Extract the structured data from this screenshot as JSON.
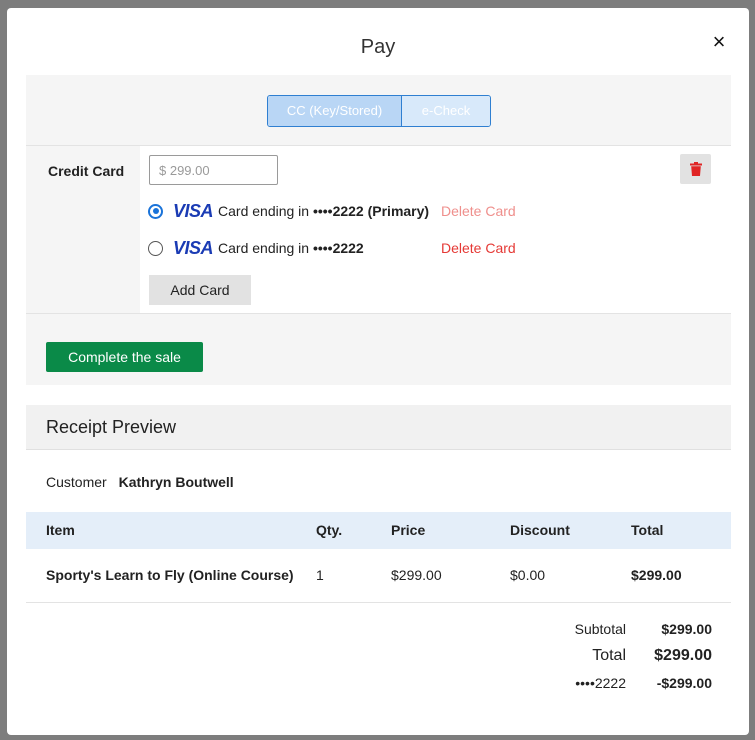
{
  "modal": {
    "title": "Pay",
    "close_glyph": "×"
  },
  "payment_tabs": [
    {
      "label": "CC (Key/Stored)",
      "active": true
    },
    {
      "label": "e-Check",
      "active": false
    }
  ],
  "credit_card": {
    "section_label": "Credit Card",
    "amount_placeholder": "$ 299.00",
    "cards": [
      {
        "brand": "VISA",
        "prefix": "Card ending in",
        "digits": "••••2222 (Primary)",
        "delete_label": "Delete Card",
        "selected": true
      },
      {
        "brand": "VISA",
        "prefix": "Card ending in",
        "digits": "••••2222",
        "delete_label": "Delete Card",
        "selected": false
      }
    ],
    "add_card_label": "Add Card"
  },
  "complete_label": "Complete the sale",
  "receipt": {
    "title": "Receipt Preview",
    "customer_label": "Customer",
    "customer_name": "Kathryn Boutwell",
    "columns": [
      "Item",
      "Qty.",
      "Price",
      "Discount",
      "Total"
    ],
    "rows": [
      {
        "item": "Sporty's Learn to Fly (Online Course)",
        "qty": "1",
        "price": "$299.00",
        "discount": "$0.00",
        "total": "$299.00"
      }
    ],
    "subtotal_label": "Subtotal",
    "subtotal_value": "$299.00",
    "total_label": "Total",
    "total_value": "$299.00",
    "payment_label": "••••2222",
    "payment_value": "-$299.00"
  },
  "colors": {
    "accent_blue": "#2f7fd1",
    "complete_green": "#0a8a48",
    "delete_red": "#e53935",
    "delete_red_faded": "#ef8f8c"
  },
  "icons": {
    "close": "close-icon",
    "trash": "trash-icon",
    "visa": "visa-logo-icon"
  }
}
